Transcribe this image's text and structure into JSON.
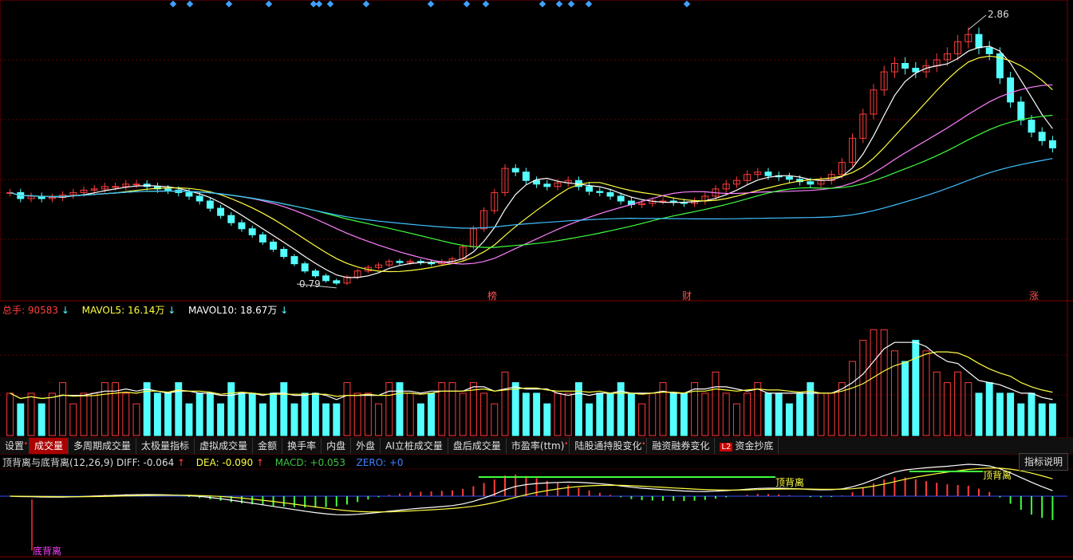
{
  "price_panel": {
    "high_label": "2.86",
    "low_label": "0.79",
    "markers": [
      "榜",
      "财",
      "涨"
    ]
  },
  "volume_panel": {
    "total_label": "总手:",
    "total_value": "90583",
    "mavol5_label": "MAVOL5:",
    "mavol5_value": "16.14万",
    "mavol10_label": "MAVOL10:",
    "mavol10_value": "18.67万"
  },
  "tabs": [
    {
      "label": "设置",
      "dot": true,
      "active": false
    },
    {
      "label": "成交量",
      "dot": false,
      "active": true
    },
    {
      "label": "多周期成交量",
      "dot": false,
      "active": false
    },
    {
      "label": "太极量指标",
      "dot": false,
      "active": false
    },
    {
      "label": "虚拟成交量",
      "dot": false,
      "active": false
    },
    {
      "label": "金额",
      "dot": false,
      "active": false
    },
    {
      "label": "换手率",
      "dot": false,
      "active": false
    },
    {
      "label": "内盘",
      "dot": false,
      "active": false
    },
    {
      "label": "外盘",
      "dot": false,
      "active": false
    },
    {
      "label": "AI立桩成交量",
      "dot": false,
      "active": false
    },
    {
      "label": "盘后成交量",
      "dot": false,
      "active": false
    },
    {
      "label": "市盈率(ttm)",
      "dot": true,
      "active": false
    },
    {
      "label": "陆股通持股变化",
      "dot": true,
      "active": false
    },
    {
      "label": "融资融券变化",
      "dot": false,
      "active": false
    },
    {
      "label": "资金抄底",
      "dot": false,
      "active": false,
      "badge": "L2"
    }
  ],
  "macd_panel": {
    "title": "顶背离与底背离(12,26,9)",
    "diff_label": "DIFF:",
    "diff_value": "-0.064",
    "dea_label": "DEA:",
    "dea_value": "-0.090",
    "macd_label": "MACD:",
    "macd_value": "+0.053",
    "zero_label": "ZERO:",
    "zero_value": "+0",
    "help_button": "指标说明",
    "signal_bottom": "底背离",
    "signal_top": "顶背离"
  },
  "colors": {
    "up": "#ff3c3c",
    "down": "#54ffff",
    "ma5": "#ffffff",
    "ma10": "#ffff40",
    "ma20": "#ff80ff",
    "ma30": "#40ff40",
    "ma60": "#40c0ff",
    "macd_pos": "#ff3c3c",
    "macd_neg": "#40ff40"
  },
  "chart_data": {
    "type": "candlestick",
    "price_extremes": {
      "high": 2.86,
      "low": 0.79
    },
    "series_close_estimate": [
      1.55,
      1.5,
      1.52,
      1.5,
      1.51,
      1.53,
      1.55,
      1.57,
      1.58,
      1.6,
      1.6,
      1.62,
      1.62,
      1.6,
      1.58,
      1.57,
      1.55,
      1.52,
      1.48,
      1.42,
      1.36,
      1.3,
      1.25,
      1.2,
      1.14,
      1.08,
      1.02,
      0.96,
      0.9,
      0.86,
      0.82,
      0.8,
      0.85,
      0.9,
      0.93,
      0.95,
      0.98,
      0.97,
      0.98,
      0.97,
      0.96,
      0.98,
      1.0,
      1.1,
      1.25,
      1.4,
      1.55,
      1.75,
      1.72,
      1.65,
      1.62,
      1.6,
      1.63,
      1.65,
      1.6,
      1.56,
      1.55,
      1.52,
      1.48,
      1.45,
      1.46,
      1.48,
      1.48,
      1.47,
      1.46,
      1.48,
      1.52,
      1.58,
      1.62,
      1.65,
      1.7,
      1.72,
      1.69,
      1.68,
      1.66,
      1.64,
      1.62,
      1.65,
      1.7,
      1.8,
      2.0,
      2.2,
      2.4,
      2.55,
      2.62,
      2.58,
      2.55,
      2.6,
      2.65,
      2.7,
      2.8,
      2.86,
      2.75,
      2.7,
      2.5,
      2.3,
      2.15,
      2.05,
      1.98,
      1.92
    ],
    "volume_estimate": [
      4,
      3,
      4,
      3,
      4,
      5,
      3,
      4,
      4,
      5,
      5,
      4,
      3,
      5,
      4,
      4,
      5,
      3,
      4,
      4,
      3,
      5,
      4,
      4,
      3,
      4,
      5,
      3,
      4,
      4,
      3,
      3,
      5,
      4,
      4,
      3,
      5,
      5,
      4,
      3,
      4,
      5,
      5,
      4,
      5,
      4,
      3,
      6,
      5,
      4,
      4,
      3,
      4,
      4,
      5,
      3,
      4,
      4,
      5,
      4,
      3,
      4,
      5,
      4,
      4,
      5,
      4,
      6,
      4,
      3,
      4,
      5,
      4,
      4,
      3,
      4,
      5,
      4,
      4,
      5,
      7,
      9,
      10,
      10,
      8,
      7,
      9,
      8,
      6,
      5,
      6,
      5,
      4,
      5,
      4,
      4,
      3,
      4,
      3,
      3
    ],
    "mavol5_latest": "16.14万",
    "mavol10_latest": "18.67万"
  }
}
